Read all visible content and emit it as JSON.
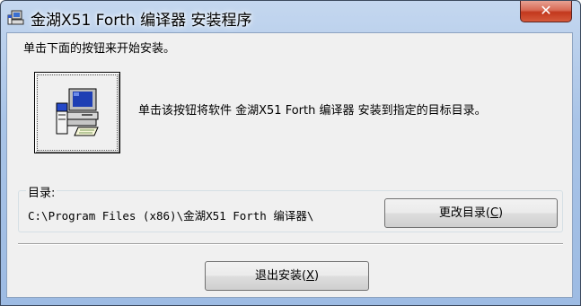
{
  "window": {
    "title": "金湖X51 Forth 编译器 安装程序",
    "close_label": "✕"
  },
  "instruction": "单击下面的按钮来开始安装。",
  "install_button": {
    "icon": "setup-computer-icon",
    "description": "单击该按钮将软件 金湖X51 Forth 编译器 安装到指定的目标目录。"
  },
  "directory": {
    "label": "目录:",
    "path": "C:\\Program Files (x86)\\金湖X51 Forth 编译器\\",
    "change_button": {
      "label": "更改目录(",
      "mnemonic": "C",
      "suffix": ")"
    }
  },
  "exit_button": {
    "label": "退出安装(",
    "mnemonic": "X",
    "suffix": ")"
  },
  "colors": {
    "titlebar": "#a9c4e7",
    "client_bg": "#f0f0f0",
    "close_button": "#c2381d"
  }
}
